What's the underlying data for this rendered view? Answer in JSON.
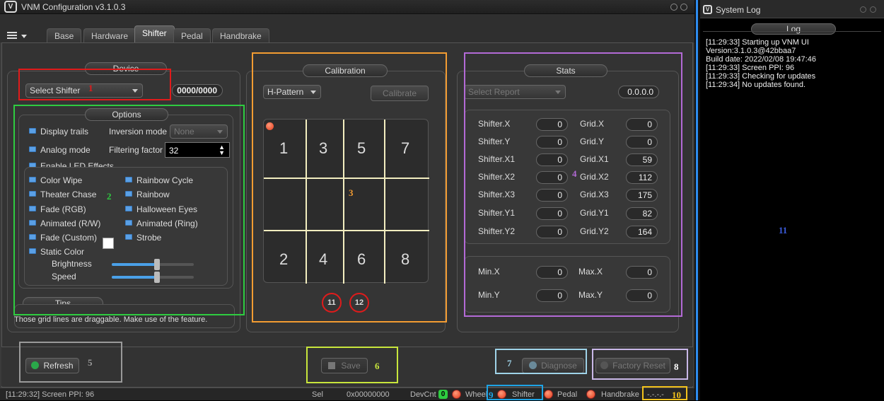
{
  "window": {
    "title": "VNM Configuration v3.1.0.3"
  },
  "tabs": [
    "Base",
    "Hardware",
    "Shifter",
    "Pedal",
    "Handbrake"
  ],
  "active_tab": "Shifter",
  "device": {
    "title": "Device",
    "select": "Select Shifter",
    "value": "0000/0000"
  },
  "options": {
    "title": "Options",
    "display_trails": "Display trails",
    "inversion_mode_label": "Inversion mode",
    "inversion_mode_value": "None",
    "analog_mode": "Analog mode",
    "filtering_label": "Filtering factor",
    "filtering_value": "32",
    "enable_led": "Enable LED Effects",
    "effects_left": [
      "Color Wipe",
      "Theater Chase",
      "Fade (RGB)",
      "Animated (R/W)",
      "Fade (Custom)",
      "Static Color"
    ],
    "effects_right": [
      "Rainbow Cycle",
      "Rainbow",
      "Halloween Eyes",
      "Animated (Ring)",
      "Strobe"
    ],
    "brightness_label": "Brightness",
    "speed_label": "Speed",
    "brightness_level": 0.55,
    "speed_level": 0.55
  },
  "tips": {
    "title": "Tips",
    "text": "Those grid lines are draggable. Make use of  the feature."
  },
  "calibration": {
    "title": "Calibration",
    "mode": "H-Pattern",
    "calibrate_label": "Calibrate",
    "top_gears": [
      "1",
      "3",
      "5",
      "7"
    ],
    "bottom_gears": [
      "2",
      "4",
      "6",
      "8"
    ],
    "circle_a": "11",
    "circle_b": "12"
  },
  "stats": {
    "title": "Stats",
    "report": "Select Report",
    "version": "0.0.0.0",
    "left": [
      {
        "label": "Shifter.X",
        "value": "0"
      },
      {
        "label": "Shifter.Y",
        "value": "0"
      },
      {
        "label": "Shifter.X1",
        "value": "0"
      },
      {
        "label": "Shifter.X2",
        "value": "0"
      },
      {
        "label": "Shifter.X3",
        "value": "0"
      },
      {
        "label": "Shifter.Y1",
        "value": "0"
      },
      {
        "label": "Shifter.Y2",
        "value": "0"
      }
    ],
    "right": [
      {
        "label": "Grid.X",
        "value": "0"
      },
      {
        "label": "Grid.Y",
        "value": "0"
      },
      {
        "label": "Grid.X1",
        "value": "59"
      },
      {
        "label": "Grid.X2",
        "value": "112"
      },
      {
        "label": "Grid.X3",
        "value": "175"
      },
      {
        "label": "Grid.Y1",
        "value": "82"
      },
      {
        "label": "Grid.Y2",
        "value": "164"
      }
    ],
    "min_x_label": "Min.X",
    "min_x": "0",
    "max_x_label": "Max.X",
    "max_x": "0",
    "min_y_label": "Min.Y",
    "min_y": "0",
    "max_y_label": "Max.Y",
    "max_y": "0"
  },
  "buttons": {
    "refresh": "Refresh",
    "save": "Save",
    "diagnose": "Diagnose",
    "factory_reset": "Factory Reset"
  },
  "statusbar": {
    "log": "[11:29:32] Screen PPI: 96",
    "sel": "Sel",
    "address": "0x00000000",
    "devcnt": "DevCnt",
    "devcnt_value": "0",
    "wheel": "Wheel",
    "shifter": "Shifter",
    "pedal": "Pedal",
    "handbrake": "Handbrake",
    "dashes": "-.-.-.-"
  },
  "annotations": [
    "1",
    "2",
    "3",
    "4",
    "5",
    "6",
    "7",
    "8",
    "9",
    "10",
    "11"
  ],
  "syslog": {
    "title": "System Log",
    "header": "Log",
    "text": "[11:29:33] Starting up VNM UI\nVersion:3.1.0.3@42bbaa7\nBuild date: 2022/02/08 19:47:46\n[11:29:33] Screen PPI: 96\n[11:29:33] Checking for updates\n[11:29:34] No updates found."
  },
  "colors": {
    "red": "#e01b1b",
    "green": "#2ecc40",
    "orange": "#f39c32",
    "purple": "#b36ad6",
    "gray": "#9a9a9a",
    "lime": "#c8e63c",
    "lightblue": "#9fd3e8",
    "lavender": "#c9b8e8",
    "cyan": "#1ea4e6",
    "gold": "#f2c21b",
    "blue": "#3b5bdb"
  }
}
